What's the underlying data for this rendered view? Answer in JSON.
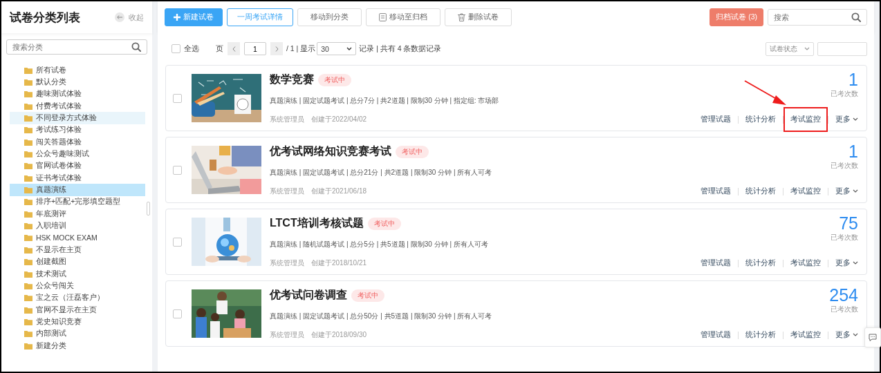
{
  "sidebar": {
    "title": "试卷分类列表",
    "collapse_label": "收起",
    "search": {
      "placeholder": "搜索分类"
    },
    "items": [
      {
        "label": "所有试卷",
        "selected": false,
        "hovered": false
      },
      {
        "label": "默认分类",
        "selected": false,
        "hovered": false
      },
      {
        "label": "趣味测试体验",
        "selected": false,
        "hovered": false
      },
      {
        "label": "付费考试体验",
        "selected": false,
        "hovered": false
      },
      {
        "label": "不同登录方式体验",
        "selected": false,
        "hovered": true
      },
      {
        "label": "考试练习体验",
        "selected": false,
        "hovered": false
      },
      {
        "label": "闯关答题体验",
        "selected": false,
        "hovered": false
      },
      {
        "label": "公众号趣味测试",
        "selected": false,
        "hovered": false
      },
      {
        "label": "官网试卷体验",
        "selected": false,
        "hovered": false
      },
      {
        "label": "证书考试体验",
        "selected": false,
        "hovered": false
      },
      {
        "label": "真题演练",
        "selected": true,
        "hovered": false
      },
      {
        "label": "排序+匹配+完形填空题型",
        "selected": false,
        "hovered": false
      },
      {
        "label": "年底测评",
        "selected": false,
        "hovered": false
      },
      {
        "label": "入职培训",
        "selected": false,
        "hovered": false
      },
      {
        "label": "HSK MOCK EXAM",
        "selected": false,
        "hovered": false
      },
      {
        "label": "不显示在主页",
        "selected": false,
        "hovered": false
      },
      {
        "label": "创建截图",
        "selected": false,
        "hovered": false
      },
      {
        "label": "技术测试",
        "selected": false,
        "hovered": false
      },
      {
        "label": "公众号闯关",
        "selected": false,
        "hovered": false
      },
      {
        "label": "宝之云（汪磊客户）",
        "selected": false,
        "hovered": false
      },
      {
        "label": "官网不显示在主页",
        "selected": false,
        "hovered": false
      },
      {
        "label": "党史知识竞赛",
        "selected": false,
        "hovered": false
      },
      {
        "label": "内部测试",
        "selected": false,
        "hovered": false
      },
      {
        "label": "新建分类",
        "selected": false,
        "hovered": false
      }
    ]
  },
  "toolbar": {
    "buttons": [
      {
        "label": "新建试卷",
        "kind": "primary"
      },
      {
        "label": "一周考试详情",
        "kind": "outline"
      },
      {
        "label": "移动到分类",
        "kind": "plain"
      },
      {
        "label": "移动至归档",
        "kind": "archive"
      },
      {
        "label": "删除试卷",
        "kind": "delete"
      }
    ],
    "archived_button": "归档试卷 (3)",
    "search": {
      "placeholder": "搜索"
    }
  },
  "list_controls": {
    "select_all": {
      "label": "全选",
      "checked": false
    },
    "page_label": "页",
    "page": "1",
    "page_total": "/ 1 | 显示",
    "page_size": "30",
    "records": "记录 | 共有 4 条数据记录",
    "status_filter": "试卷状态"
  },
  "exams": [
    {
      "title": "数学竞赛",
      "status": "考试中",
      "meta": "真题演练 | 固定试题考试 | 总分7分 | 共2道题 | 限制30 分钟 | 指定组: 市场部",
      "author": "系统管理员",
      "created": "创建于2022/04/02",
      "count": "1",
      "count_label": "已考次数",
      "checked": false,
      "image": {
        "kind": "picture"
      },
      "actions": [
        {
          "label": "管理试题",
          "kind": "link",
          "annotated": false
        },
        {
          "label": "统计分析",
          "kind": "link",
          "annotated": false
        },
        {
          "label": "考试监控",
          "kind": "link",
          "annotated": true
        },
        {
          "label": "更多",
          "kind": "menu",
          "annotated": false
        }
      ]
    },
    {
      "title": "优考试网络知识竞赛考试",
      "status": "考试中",
      "meta": "真题演练 | 固定试题考试 | 总分21分 | 共2道题 | 限制30 分钟 | 所有人可考",
      "author": "系统管理员",
      "created": "创建于2021/06/18",
      "count": "1",
      "count_label": "已考次数",
      "checked": false,
      "image": {
        "kind": "picture"
      },
      "actions": [
        {
          "label": "管理试题",
          "kind": "link",
          "annotated": false
        },
        {
          "label": "统计分析",
          "kind": "link",
          "annotated": false
        },
        {
          "label": "考试监控",
          "kind": "link",
          "annotated": false
        },
        {
          "label": "更多",
          "kind": "menu",
          "annotated": false
        }
      ]
    },
    {
      "title": "LTCT培训考核试题",
      "status": "考试中",
      "meta": "真题演练 | 随机试题考试 | 总分5分 | 共5道题 | 限制30 分钟 | 所有人可考",
      "author": "系统管理员",
      "created": "创建于2018/10/21",
      "count": "75",
      "count_label": "已考次数",
      "checked": false,
      "image": {
        "kind": "picture"
      },
      "actions": [
        {
          "label": "管理试题",
          "kind": "link",
          "annotated": false
        },
        {
          "label": "统计分析",
          "kind": "link",
          "annotated": false
        },
        {
          "label": "考试监控",
          "kind": "link",
          "annotated": false
        },
        {
          "label": "更多",
          "kind": "menu",
          "annotated": false
        }
      ]
    },
    {
      "title": "优考试问卷调查",
      "status": "考试中",
      "meta": "真题演练 | 固定试题考试 | 总分50分 | 共5道题 | 限制30 分钟 | 所有人可考",
      "author": "系统管理员",
      "created": "创建于2018/09/30",
      "count": "254",
      "count_label": "已考次数",
      "checked": false,
      "image": {
        "kind": "picture"
      },
      "actions": [
        {
          "label": "管理试题",
          "kind": "link",
          "annotated": false
        },
        {
          "label": "统计分析",
          "kind": "link",
          "annotated": false
        },
        {
          "label": "考试监控",
          "kind": "link",
          "annotated": false
        },
        {
          "label": "更多",
          "kind": "menu",
          "annotated": false
        }
      ]
    }
  ]
}
